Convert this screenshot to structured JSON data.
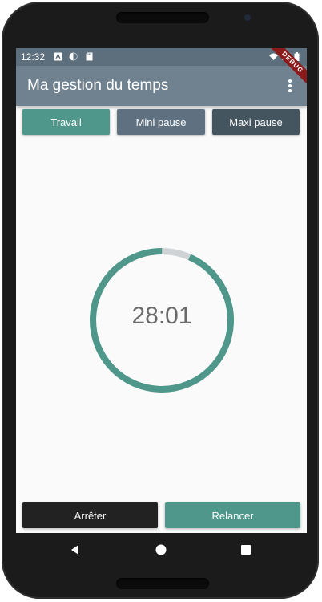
{
  "status_bar": {
    "time": "12:32",
    "debug_label": "DEBUG"
  },
  "app_bar": {
    "title": "Ma gestion du temps"
  },
  "modes": {
    "work_label": "Travail",
    "short_break_label": "Mini pause",
    "long_break_label": "Maxi pause"
  },
  "timer": {
    "display": "28:01",
    "progress": 0.934,
    "track_color": "#cfd3d5",
    "progress_color": "#4e978a"
  },
  "actions": {
    "stop_label": "Arrêter",
    "restart_label": "Relancer"
  },
  "colors": {
    "primary": "#708290",
    "work": "#4e978a",
    "short_break": "#5f7180",
    "long_break": "#455560",
    "stop": "#222222"
  }
}
